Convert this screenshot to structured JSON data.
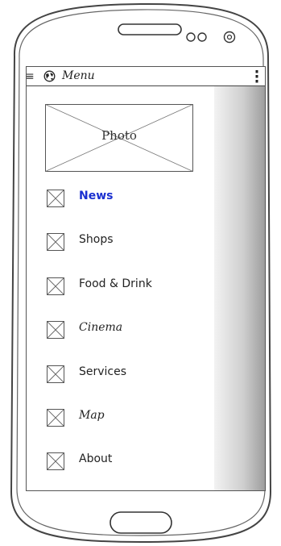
{
  "appbar": {
    "title": "Menu",
    "menu_icon": "hamburger-icon",
    "app_icon": "globe-icon",
    "overflow_icon": "more-vert-icon"
  },
  "drawer": {
    "photo_label": "Photo",
    "items": [
      {
        "label": "News",
        "active": true
      },
      {
        "label": "Shops"
      },
      {
        "label": "Food & Drink"
      },
      {
        "label": "Cinema"
      },
      {
        "label": "Services"
      },
      {
        "label": "Map"
      },
      {
        "label": "About"
      }
    ]
  },
  "colors": {
    "active_item": "#1a2fd0",
    "outline": "#444444"
  }
}
